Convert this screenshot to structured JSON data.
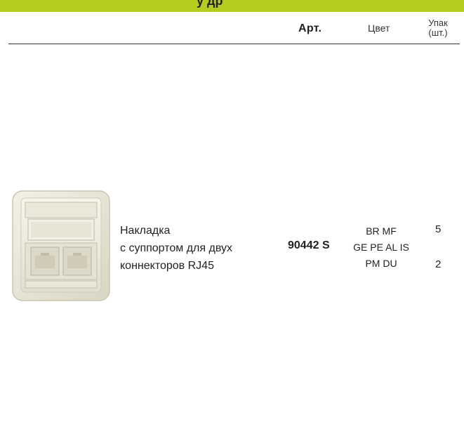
{
  "top_band": {
    "text": "у     др"
  },
  "table_header": {
    "art_label": "Арт.",
    "color_label": "Цвет",
    "pack_line1": "Упак",
    "pack_line2": "(шт.)"
  },
  "product": {
    "image_icon": "rj45-double-socket-cover",
    "description_lines": [
      "Накладка",
      "с суппортом для двух",
      "коннекторов RJ45"
    ],
    "article": "90442 S",
    "color_lines": [
      "BR MF",
      "GE PE AL IS",
      "PM DU"
    ],
    "pack_values": [
      "5",
      "2"
    ]
  },
  "colors": {
    "band": "#b5cc1e",
    "rule": "#333333"
  }
}
